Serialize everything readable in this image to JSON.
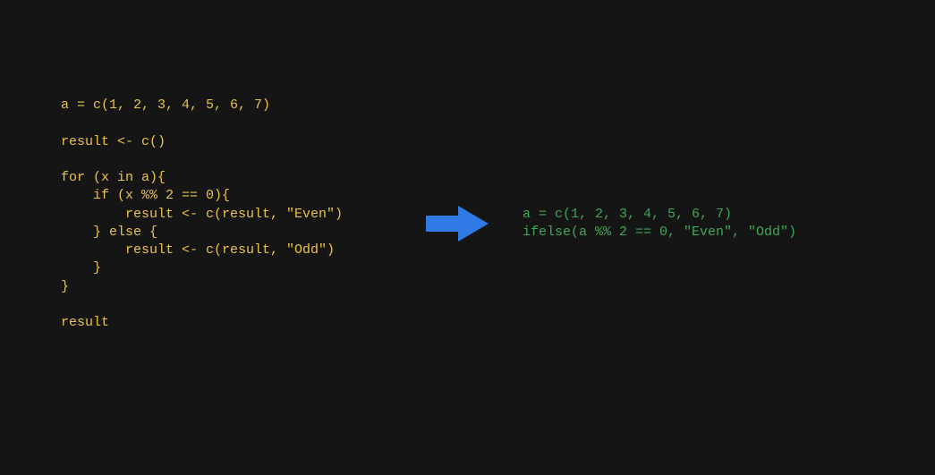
{
  "left_code": {
    "lines": [
      "a = c(1, 2, 3, 4, 5, 6, 7)",
      "",
      "result <- c()",
      "",
      "for (x in a){",
      "    if (x %% 2 == 0){",
      "        result <- c(result, \"Even\")",
      "    } else {",
      "        result <- c(result, \"Odd\")",
      "    }",
      "}",
      "",
      "result"
    ]
  },
  "right_code": {
    "lines": [
      "a = c(1, 2, 3, 4, 5, 6, 7)",
      "ifelse(a %% 2 == 0, \"Even\", \"Odd\")"
    ]
  },
  "colors": {
    "background": "#151515",
    "left_text": "#eac24f",
    "right_text": "#3fa855",
    "arrow": "#2f7ae5"
  }
}
